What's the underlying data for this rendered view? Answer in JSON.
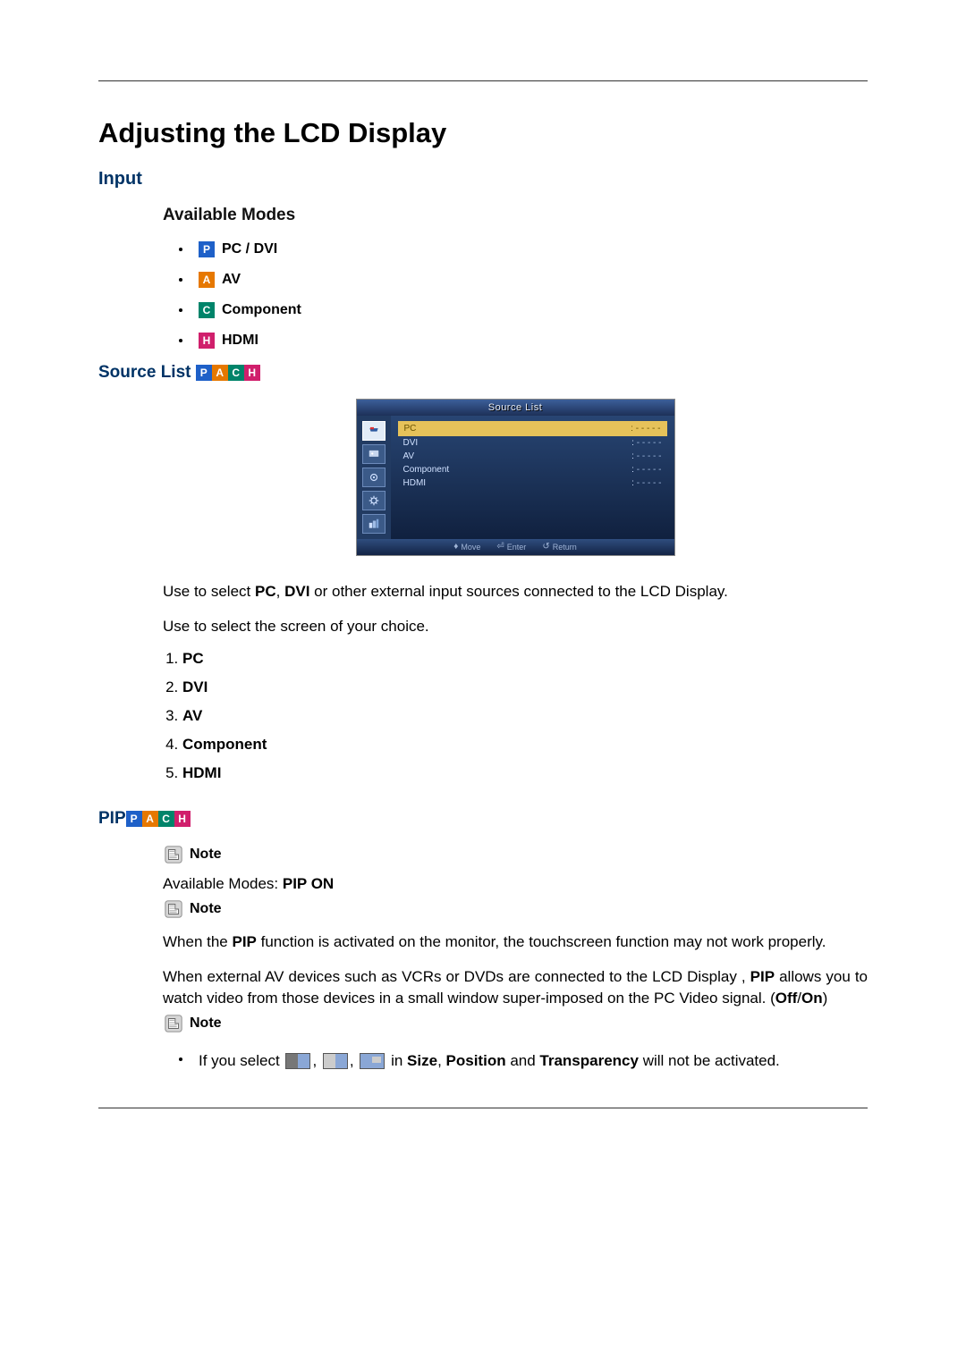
{
  "title": "Adjusting the LCD Display",
  "input_heading": "Input",
  "available_modes_heading": "Available Modes",
  "badges": {
    "p": "P",
    "a": "A",
    "c": "C",
    "h": "H"
  },
  "modes": {
    "pc_dvi": "PC / DVI",
    "av": "AV",
    "component": "Component",
    "hdmi": "HDMI"
  },
  "source_list_heading": "Source List",
  "osd": {
    "title": "Source List",
    "items": [
      {
        "label": "PC",
        "value": "- - - - -",
        "selected": true
      },
      {
        "label": "DVI",
        "value": "- - - - -",
        "selected": false
      },
      {
        "label": "AV",
        "value": "- - - - -",
        "selected": false
      },
      {
        "label": "Component",
        "value": "- - - - -",
        "selected": false
      },
      {
        "label": "HDMI",
        "value": "- - - - -",
        "selected": false
      }
    ],
    "footer": {
      "move": "Move",
      "enter": "Enter",
      "return": "Return"
    }
  },
  "source_desc_1_a": "Use to select ",
  "source_desc_1_pc": "PC",
  "source_desc_1_comma": ", ",
  "source_desc_1_dvi": "DVI",
  "source_desc_1_b": " or other external input sources connected to the LCD Display.",
  "source_desc_2": "Use to select the screen of your choice.",
  "numbered": [
    "PC",
    "DVI",
    "AV",
    "Component",
    "HDMI"
  ],
  "pip_heading": "PIP",
  "note_label": "Note",
  "pip_avail_a": "Available Modes: ",
  "pip_avail_b": "PIP ON",
  "pip_note1_a": "When the ",
  "pip_note1_b": "PIP",
  "pip_note1_c": " function is activated on the monitor, the touchscreen function may not work properly.",
  "pip_note2_a": "When external AV devices such as VCRs or DVDs are connected to the LCD Display , ",
  "pip_note2_b": "PIP",
  "pip_note2_c": " allows you to watch video from those devices in a small window super-imposed on the PC Video signal. (",
  "pip_note2_off": "Off",
  "pip_note2_slash": "/",
  "pip_note2_on": "On",
  "pip_note2_end": ")",
  "pip_bullet_a": "If you select ",
  "pip_bullet_b": " in ",
  "pip_bullet_size": "Size",
  "pip_bullet_c": ", ",
  "pip_bullet_position": "Position",
  "pip_bullet_d": " and ",
  "pip_bullet_transparency": "Transparency",
  "pip_bullet_e": " will not be activated."
}
